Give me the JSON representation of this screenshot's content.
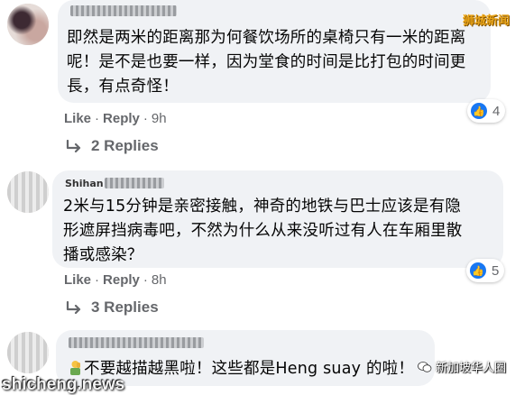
{
  "comments": [
    {
      "text_lines": [
        "即然是两米的距离那为何餐饮场所的桌椅只有一米的距离",
        "呢！是不是也要一样，因为堂食的时间是比打包的时间更",
        "長，有点奇怪！"
      ],
      "actions": {
        "like": "Like",
        "reply": "Reply",
        "time": "9h"
      },
      "reactions": {
        "icon": "like-icon",
        "count": "4"
      },
      "replies_label": "2 Replies"
    },
    {
      "author_partial": "Shihan",
      "text_lines": [
        "2米与15分钟是亲密接触，神奇的地铁与巴士应该是有隐",
        "形遮屏挡病毒吧，不然为什么从来没听过有人在车厢里散",
        "播或感染？"
      ],
      "actions": {
        "like": "Like",
        "reply": "Reply",
        "time": "8h"
      },
      "reactions": {
        "icon": "like-icon",
        "count": "5"
      },
      "replies_label": "3 Replies"
    },
    {
      "text_lines": [
        "不要越描越黑啦！这些都是Heng suay 的啦！"
      ],
      "emoji": "person-facepalm-emoji"
    }
  ],
  "watermarks": {
    "top_right": "狮城新闻",
    "bottom_left": "shicheng.news",
    "bottom_right": "新加坡华人圈"
  },
  "colors": {
    "like_blue": "#1877f2",
    "bubble_gray": "#f0f2f5",
    "meta_gray": "#65676b"
  }
}
